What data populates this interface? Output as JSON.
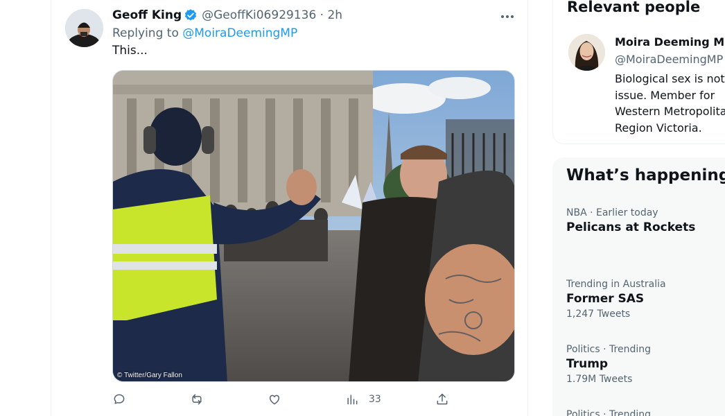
{
  "tweet": {
    "display_name": "Geoff King",
    "handle_time": "@GeoffKi06929136 · 2h",
    "replying_prefix": "Replying to",
    "replying_to": "@MoiraDeemingMP",
    "text": "This...",
    "photo_credit": "© Twitter/Gary Fallon",
    "actions": {
      "reply_icon": "reply-icon",
      "retweet_icon": "retweet-icon",
      "like_icon": "heart-icon",
      "views_icon": "views-icon",
      "views_count": "33",
      "share_icon": "share-icon"
    },
    "colors": {
      "accent": "#1d9bf0",
      "muted": "#536471",
      "text": "#0f1419"
    }
  },
  "sidebar": {
    "relevant_title": "Relevant people",
    "person": {
      "name": "Moira Deeming MP",
      "handle": "@MoiraDeemingMP",
      "bio": "Biological sex is not an issue. Member for Western Metropolitan Region Victoria."
    },
    "happening_title": "What’s happening",
    "trends": [
      {
        "meta": "NBA · Earlier today",
        "name": "Pelicans at Rockets",
        "count": ""
      },
      {
        "meta": "Trending in Australia",
        "name": "Former SAS",
        "count": "1,247 Tweets"
      },
      {
        "meta": "Politics · Trending",
        "name": "Trump",
        "count": "1.79M Tweets"
      },
      {
        "meta": "Politics · Trending",
        "name": "",
        "count": ""
      }
    ]
  }
}
